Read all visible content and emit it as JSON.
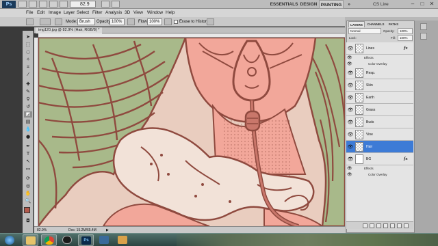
{
  "app": {
    "logo": "Ps",
    "zoom_value": "82.9",
    "workspaces": [
      "ESSENTIALS",
      "DESIGN",
      "PAINTING"
    ],
    "active_workspace": "PAINTING",
    "cs_live": "CS Live",
    "window_controls": [
      "–",
      "□",
      "✕"
    ]
  },
  "menu": [
    "File",
    "Edit",
    "Image",
    "Layer",
    "Select",
    "Filter",
    "Analysis",
    "3D",
    "View",
    "Window",
    "Help"
  ],
  "options_bar": {
    "mode_label": "Mode:",
    "mode_value": "Brush",
    "opacity_label": "Opacity:",
    "opacity_value": "100%",
    "flow_label": "Flow:",
    "flow_value": "100%",
    "erase_history_label": "Erase to History"
  },
  "document": {
    "tab_title": "img120.jpg @ 82.9% (Hair, RGB/8) *",
    "status_zoom": "82.9%",
    "status_doc": "Doc: 15.2M/65.4M"
  },
  "colors": {
    "foreground": "#b35a4c",
    "background": "#ffffff",
    "line_color": "#8f4a3f",
    "hair_green": "#a8b98a",
    "skin": "#f2a79a",
    "smoke": "#f2e2d8",
    "selected_layer": "#3d7bd6"
  },
  "layers_panel": {
    "tabs": [
      "LAYERS",
      "CHANNELS",
      "PATHS"
    ],
    "active_tab": "LAYERS",
    "blend_mode": "Normal",
    "opacity_label": "Opacity:",
    "opacity_value": "100%",
    "lock_label": "Lock:",
    "fill_label": "Fill:",
    "fill_value": "100%",
    "layers": [
      {
        "name": "Lines",
        "fx": "fx",
        "effects": [
          "Effects",
          "Color Overlay"
        ],
        "selected": false
      },
      {
        "name": "Resp.",
        "fx": "",
        "selected": false
      },
      {
        "name": "Skin",
        "fx": "",
        "selected": false
      },
      {
        "name": "Earth",
        "fx": "",
        "selected": false
      },
      {
        "name": "Grass",
        "fx": "",
        "selected": false
      },
      {
        "name": "Buds",
        "fx": "",
        "selected": false
      },
      {
        "name": "Vine",
        "fx": "",
        "selected": false
      },
      {
        "name": "Hair",
        "fx": "",
        "selected": true
      },
      {
        "name": "BG",
        "fx": "fx",
        "effects": [
          "Effects",
          "Color Overlay"
        ],
        "selected": false
      }
    ]
  },
  "taskbar": {
    "apps": [
      "start-orb",
      "explorer",
      "chrome",
      "media-player",
      "photoshop",
      "gallery",
      "paint"
    ]
  }
}
